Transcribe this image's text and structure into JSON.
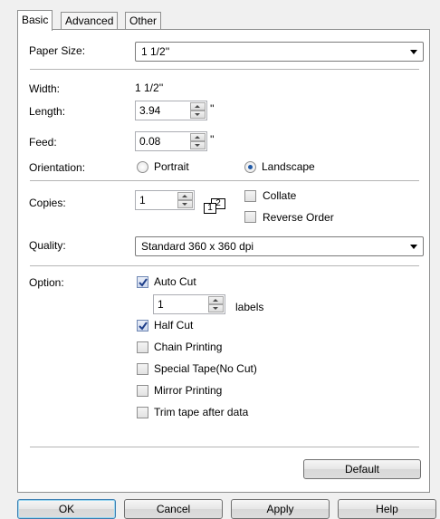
{
  "tabs": [
    {
      "label": "Basic",
      "active": true
    },
    {
      "label": "Advanced",
      "active": false
    },
    {
      "label": "Other",
      "active": false
    }
  ],
  "paper_size": {
    "label": "Paper Size:",
    "value": "1 1/2''"
  },
  "width": {
    "label": "Width:",
    "value": "1 1/2''"
  },
  "length": {
    "label": "Length:",
    "value": "3.94",
    "unit": "''"
  },
  "feed": {
    "label": "Feed:",
    "value": "0.08",
    "unit": "''"
  },
  "orientation": {
    "label": "Orientation:",
    "options": [
      {
        "label": "Portrait",
        "selected": false
      },
      {
        "label": "Landscape",
        "selected": true
      }
    ]
  },
  "copies": {
    "label": "Copies:",
    "value": "1",
    "icon_labels": [
      "1",
      "2"
    ],
    "collate": {
      "label": "Collate",
      "checked": false
    },
    "reverse_order": {
      "label": "Reverse Order",
      "checked": false
    }
  },
  "quality": {
    "label": "Quality:",
    "value": "Standard 360 x 360 dpi"
  },
  "option": {
    "label": "Option:",
    "auto_cut": {
      "label": "Auto Cut",
      "checked": true
    },
    "labels": {
      "value": "1",
      "suffix": "labels"
    },
    "half_cut": {
      "label": "Half Cut",
      "checked": true
    },
    "chain_printing": {
      "label": "Chain Printing",
      "checked": false
    },
    "special_tape": {
      "label": "Special Tape(No Cut)",
      "checked": false
    },
    "mirror_printing": {
      "label": "Mirror Printing",
      "checked": false
    },
    "trim_tape": {
      "label": "Trim tape after data",
      "checked": false
    }
  },
  "default_button": "Default",
  "dialog_buttons": {
    "ok": "OK",
    "cancel": "Cancel",
    "apply": "Apply",
    "help": "Help"
  }
}
